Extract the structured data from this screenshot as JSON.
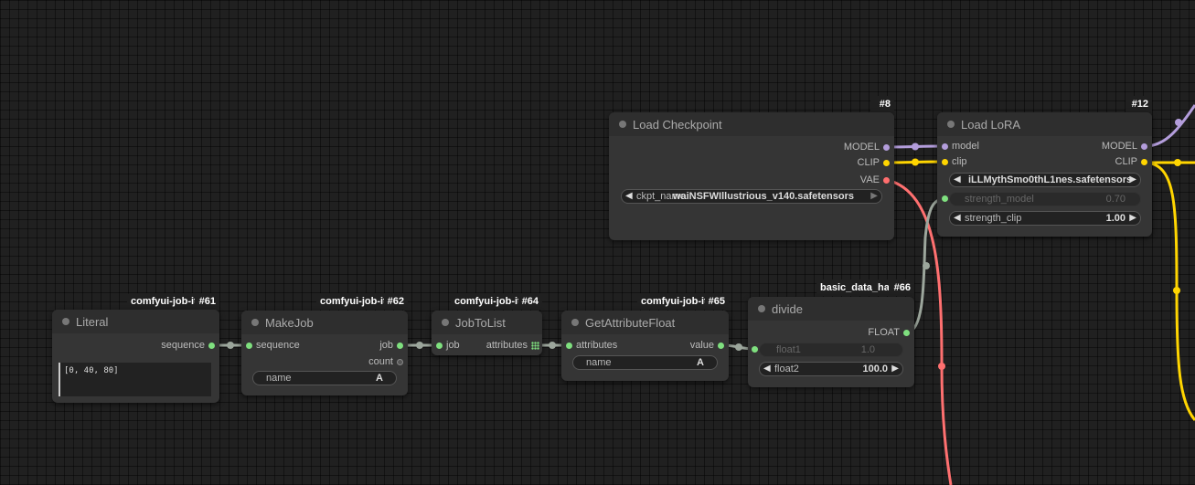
{
  "colors": {
    "model": "#b39ddb",
    "clip": "#ffd500",
    "vae": "#ff6e6e",
    "float": "#7fe07f",
    "generic": "#9ca69c"
  },
  "nodes": {
    "load_checkpoint": {
      "badge_num": "#8",
      "title": "Load Checkpoint",
      "outputs": [
        "MODEL",
        "CLIP",
        "VAE"
      ],
      "ckpt_label": "ckpt_name",
      "ckpt_value": "waiNSFWIllustrious_v140.safetensors"
    },
    "load_lora": {
      "badge_num": "#12",
      "title": "Load LoRA",
      "inputs": [
        "model",
        "clip"
      ],
      "outputs": [
        "MODEL",
        "CLIP"
      ],
      "lora_value": "iLLMythSmo0thL1nes.safetensors",
      "strength_model_label": "strength_model",
      "strength_model_value": "0.70",
      "strength_clip_label": "strength_clip",
      "strength_clip_value": "1.00"
    },
    "literal": {
      "badge_src": "comfyui-job-ite",
      "badge_num": "#61",
      "title": "Literal",
      "output": "sequence",
      "text": "[0, 40, 80]"
    },
    "makejob": {
      "badge_src": "comfyui-job-ite",
      "badge_num": "#62",
      "title": "MakeJob",
      "input": "sequence",
      "outputs": [
        "job",
        "count"
      ],
      "name_label": "name",
      "name_value": "A"
    },
    "jobtolist": {
      "badge_src": "comfyui-job-ite",
      "badge_num": "#64",
      "title": "JobToList",
      "input": "job",
      "output": "attributes"
    },
    "getattr": {
      "badge_src": "comfyui-job-ite",
      "badge_num": "#65",
      "title": "GetAttributeFloat",
      "input": "attributes",
      "output": "value",
      "name_label": "name",
      "name_value": "A"
    },
    "divide": {
      "badge_src": "basic_data_han",
      "badge_num": "#66",
      "title": "divide",
      "output": "FLOAT",
      "float1_label": "float1",
      "float1_value": "1.0",
      "float2_label": "float2",
      "float2_value": "100.0"
    }
  }
}
